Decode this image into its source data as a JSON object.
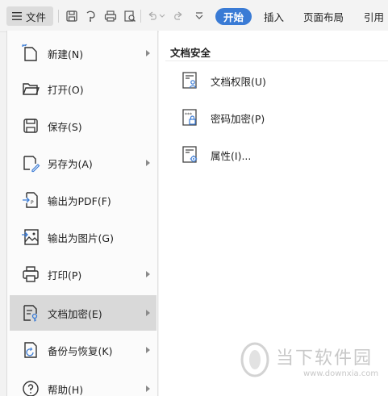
{
  "toolbar": {
    "file_label": "文件",
    "tabs": [
      {
        "label": "开始",
        "active": true
      },
      {
        "label": "插入",
        "active": false
      },
      {
        "label": "页面布局",
        "active": false
      },
      {
        "label": "引用",
        "active": false
      }
    ],
    "icons": [
      "menu-icon",
      "save-icon",
      "revision-icon",
      "print-icon",
      "print-preview-icon",
      "undo-icon",
      "redo-icon",
      "quick-access-dropdown-icon"
    ]
  },
  "menu": {
    "items": [
      {
        "label": "新建(N)",
        "icon": "new-file-icon",
        "has_arrow": true
      },
      {
        "label": "打开(O)",
        "icon": "folder-open-icon",
        "has_arrow": false
      },
      {
        "label": "保存(S)",
        "icon": "save-icon",
        "has_arrow": false
      },
      {
        "label": "另存为(A)",
        "icon": "save-as-icon",
        "has_arrow": true
      },
      {
        "label": "输出为PDF(F)",
        "icon": "export-pdf-icon",
        "has_arrow": false
      },
      {
        "label": "输出为图片(G)",
        "icon": "export-image-icon",
        "has_arrow": false
      },
      {
        "label": "打印(P)",
        "icon": "printer-icon",
        "has_arrow": true
      },
      {
        "label": "文档加密(E)",
        "icon": "document-encrypt-icon",
        "has_arrow": true,
        "selected": true
      },
      {
        "label": "备份与恢复(K)",
        "icon": "backup-restore-icon",
        "has_arrow": true
      },
      {
        "label": "帮助(H)",
        "icon": "help-icon",
        "has_arrow": true
      }
    ]
  },
  "submenu": {
    "title": "文档安全",
    "items": [
      {
        "label": "文档权限(U)",
        "icon": "document-permission-icon"
      },
      {
        "label": "密码加密(P)",
        "icon": "password-encrypt-icon"
      },
      {
        "label": "属性(I)...",
        "icon": "document-properties-icon"
      }
    ]
  },
  "watermark": {
    "title": "当下软件园",
    "url": "www.downxia.com"
  },
  "colors": {
    "accent": "#3a7bd5",
    "selected_bg": "#d9d9d9"
  }
}
